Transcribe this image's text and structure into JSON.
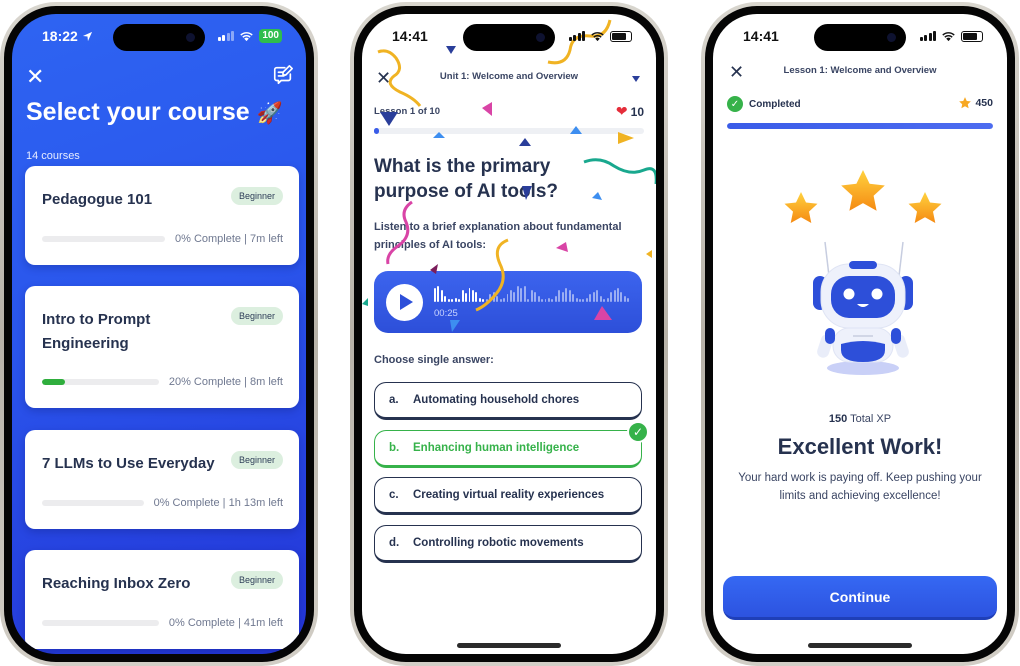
{
  "phone1": {
    "status": {
      "time": "18:22",
      "battery": "100"
    },
    "title": "Select your course",
    "title_emoji": "🚀",
    "course_count": "14 courses",
    "courses": [
      {
        "title": "Pedagogue 101",
        "level": "Beginner",
        "progress_pct": 0,
        "progress_text": "0% Complete | 7m left"
      },
      {
        "title": "Intro to Prompt Engineering",
        "level": "Beginner",
        "progress_pct": 20,
        "progress_text": "20% Complete | 8m left"
      },
      {
        "title": "7 LLMs to Use Everyday",
        "level": "Beginner",
        "progress_pct": 0,
        "progress_text": "0% Complete | 1h 13m left"
      },
      {
        "title": "Reaching Inbox Zero",
        "level": "Beginner",
        "progress_pct": 0,
        "progress_text": "0% Complete | 41m left"
      }
    ]
  },
  "phone2": {
    "status": {
      "time": "14:41"
    },
    "unit_title": "Unit 1: Welcome and Overview",
    "lesson_label": "Lesson 1 of 10",
    "hearts": "10",
    "lesson_progress_pct": 2,
    "question": "What is the primary purpose of AI tools?",
    "description": "Listen to a brief explanation about fundamental principles of AI tools:",
    "audio": {
      "time": "00:25",
      "played_fraction": 0.25
    },
    "choose_label": "Choose single answer:",
    "answers": [
      {
        "letter": "a.",
        "text": "Automating household chores",
        "state": "default"
      },
      {
        "letter": "b.",
        "text": "Enhancing human intelligence",
        "state": "correct"
      },
      {
        "letter": "c.",
        "text": "Creating virtual reality experiences",
        "state": "default"
      },
      {
        "letter": "d.",
        "text": "Controlling robotic movements",
        "state": "default"
      }
    ],
    "check_glyph": "✓"
  },
  "phone3": {
    "status": {
      "time": "14:41"
    },
    "lesson_title": "Lesson 1: Welcome and Overview",
    "completed_label": "Completed",
    "xp_points": "450",
    "lesson_progress_pct": 100,
    "total_xp_value": "150",
    "total_xp_label": "Total XP",
    "headline": "Excellent Work!",
    "message": "Your hard work is paying off. Keep pushing your limits and achieving excellence!",
    "continue_label": "Continue",
    "stars_earned": 3
  },
  "icons": {
    "close": "✕",
    "check": "✓",
    "heart": "❤"
  },
  "colors": {
    "brand_blue": "#2d53e0",
    "success_green": "#36b24a",
    "text_dark": "#26324f",
    "badge_green_bg": "#dcefdf"
  }
}
